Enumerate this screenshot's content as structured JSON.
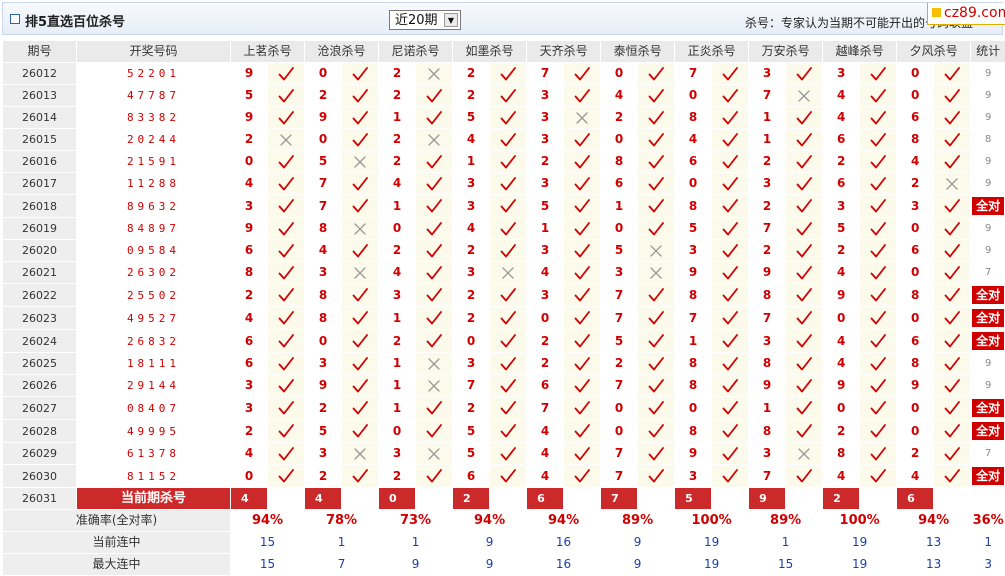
{
  "header": {
    "title": "排5直选百位杀号",
    "select_value": "近20期",
    "note": "杀号：专家认为当期不可能开出的号码",
    "note_tail": "联盟",
    "logo_text": "cz89.com"
  },
  "colors": {
    "red": "#d00000",
    "blue": "#1a3fb0",
    "mark_bg": "#fbfaeb"
  },
  "columns": {
    "issue": "期号",
    "draw": "开奖号码",
    "experts": [
      "上茗杀号",
      "沧浪杀号",
      "尼诺杀号",
      "如墨杀号",
      "天齐杀号",
      "泰恒杀号",
      "正炎杀号",
      "万安杀号",
      "越峰杀号",
      "夕风杀号"
    ],
    "stat": "统计"
  },
  "rows": [
    {
      "issue": "26012",
      "draw": "52201",
      "k": [
        9,
        0,
        2,
        2,
        7,
        0,
        7,
        3,
        3,
        0
      ],
      "hit": [
        1,
        1,
        0,
        1,
        1,
        1,
        1,
        1,
        1,
        1
      ],
      "stat": "9"
    },
    {
      "issue": "26013",
      "draw": "47787",
      "k": [
        5,
        2,
        2,
        2,
        3,
        4,
        0,
        7,
        4,
        0
      ],
      "hit": [
        1,
        1,
        1,
        1,
        1,
        1,
        1,
        0,
        1,
        1
      ],
      "stat": "9"
    },
    {
      "issue": "26014",
      "draw": "83382",
      "k": [
        9,
        9,
        1,
        5,
        3,
        2,
        8,
        1,
        4,
        6
      ],
      "hit": [
        1,
        1,
        1,
        1,
        0,
        1,
        1,
        1,
        1,
        1
      ],
      "stat": "9"
    },
    {
      "issue": "26015",
      "draw": "20244",
      "k": [
        2,
        0,
        2,
        4,
        3,
        0,
        4,
        1,
        6,
        8
      ],
      "hit": [
        0,
        1,
        0,
        1,
        1,
        1,
        1,
        1,
        1,
        1
      ],
      "stat": "8"
    },
    {
      "issue": "26016",
      "draw": "21591",
      "k": [
        0,
        5,
        2,
        1,
        2,
        8,
        6,
        2,
        2,
        4
      ],
      "hit": [
        1,
        0,
        1,
        1,
        1,
        1,
        1,
        1,
        1,
        1
      ],
      "stat": "9"
    },
    {
      "issue": "26017",
      "draw": "11288",
      "k": [
        4,
        7,
        4,
        3,
        3,
        6,
        0,
        3,
        6,
        2
      ],
      "hit": [
        1,
        1,
        1,
        1,
        1,
        1,
        1,
        1,
        1,
        0
      ],
      "stat": "9"
    },
    {
      "issue": "26018",
      "draw": "89632",
      "k": [
        3,
        7,
        1,
        3,
        5,
        1,
        8,
        2,
        3,
        3
      ],
      "hit": [
        1,
        1,
        1,
        1,
        1,
        1,
        1,
        1,
        1,
        1
      ],
      "stat": "全对"
    },
    {
      "issue": "26019",
      "draw": "84897",
      "k": [
        9,
        8,
        0,
        4,
        1,
        0,
        5,
        7,
        5,
        0
      ],
      "hit": [
        1,
        0,
        1,
        1,
        1,
        1,
        1,
        1,
        1,
        1
      ],
      "stat": "9"
    },
    {
      "issue": "26020",
      "draw": "09584",
      "k": [
        6,
        4,
        2,
        2,
        3,
        5,
        3,
        2,
        2,
        6
      ],
      "hit": [
        1,
        1,
        1,
        1,
        1,
        0,
        1,
        1,
        1,
        1
      ],
      "stat": "9"
    },
    {
      "issue": "26021",
      "draw": "26302",
      "k": [
        8,
        3,
        4,
        3,
        4,
        3,
        9,
        9,
        4,
        0
      ],
      "hit": [
        1,
        0,
        1,
        0,
        1,
        0,
        1,
        1,
        1,
        1
      ],
      "stat": "7"
    },
    {
      "issue": "26022",
      "draw": "25502",
      "k": [
        2,
        8,
        3,
        2,
        3,
        7,
        8,
        8,
        9,
        8
      ],
      "hit": [
        1,
        1,
        1,
        1,
        1,
        1,
        1,
        1,
        1,
        1
      ],
      "stat": "全对"
    },
    {
      "issue": "26023",
      "draw": "49527",
      "k": [
        4,
        8,
        1,
        2,
        0,
        7,
        7,
        7,
        0,
        0
      ],
      "hit": [
        1,
        1,
        1,
        1,
        1,
        1,
        1,
        1,
        1,
        1
      ],
      "stat": "全对"
    },
    {
      "issue": "26024",
      "draw": "26832",
      "k": [
        6,
        0,
        2,
        0,
        2,
        5,
        1,
        3,
        4,
        6
      ],
      "hit": [
        1,
        1,
        1,
        1,
        1,
        1,
        1,
        1,
        1,
        1
      ],
      "stat": "全对"
    },
    {
      "issue": "26025",
      "draw": "18111",
      "k": [
        6,
        3,
        1,
        3,
        2,
        2,
        8,
        8,
        4,
        8
      ],
      "hit": [
        1,
        1,
        0,
        1,
        1,
        1,
        1,
        1,
        1,
        1
      ],
      "stat": "9"
    },
    {
      "issue": "26026",
      "draw": "29144",
      "k": [
        3,
        9,
        1,
        7,
        6,
        7,
        8,
        9,
        9,
        9
      ],
      "hit": [
        1,
        1,
        0,
        1,
        1,
        1,
        1,
        1,
        1,
        1
      ],
      "stat": "9"
    },
    {
      "issue": "26027",
      "draw": "08407",
      "k": [
        3,
        2,
        1,
        2,
        7,
        0,
        0,
        1,
        0,
        0
      ],
      "hit": [
        1,
        1,
        1,
        1,
        1,
        1,
        1,
        1,
        1,
        1
      ],
      "stat": "全对"
    },
    {
      "issue": "26028",
      "draw": "49995",
      "k": [
        2,
        5,
        0,
        5,
        4,
        0,
        8,
        8,
        2,
        0
      ],
      "hit": [
        1,
        1,
        1,
        1,
        1,
        1,
        1,
        1,
        1,
        1
      ],
      "stat": "全对"
    },
    {
      "issue": "26029",
      "draw": "61378",
      "k": [
        4,
        3,
        3,
        5,
        4,
        7,
        9,
        3,
        8,
        2
      ],
      "hit": [
        1,
        0,
        0,
        1,
        1,
        1,
        1,
        0,
        1,
        1
      ],
      "stat": "7"
    },
    {
      "issue": "26030",
      "draw": "81152",
      "k": [
        0,
        2,
        2,
        6,
        4,
        7,
        3,
        7,
        4,
        4
      ],
      "hit": [
        1,
        1,
        1,
        1,
        1,
        1,
        1,
        1,
        1,
        1
      ],
      "stat": "全对"
    }
  ],
  "current": {
    "issue": "26031",
    "label": "当前期杀号",
    "k": [
      "4",
      "4",
      "0",
      "2",
      "6",
      "7",
      "5",
      "9",
      "2",
      "6"
    ]
  },
  "summary": {
    "accuracy_label": "准确率(全对率)",
    "accuracy": [
      "94%",
      "78%",
      "73%",
      "94%",
      "94%",
      "89%",
      "100%",
      "89%",
      "100%",
      "94%"
    ],
    "accuracy_stat": "36%",
    "streak_label": "当前连中",
    "streak": [
      "15",
      "1",
      "1",
      "9",
      "16",
      "9",
      "19",
      "1",
      "19",
      "13"
    ],
    "streak_stat": "1",
    "max_label": "最大连中",
    "max": [
      "15",
      "7",
      "9",
      "9",
      "16",
      "9",
      "19",
      "15",
      "19",
      "13"
    ],
    "max_stat": "3"
  }
}
